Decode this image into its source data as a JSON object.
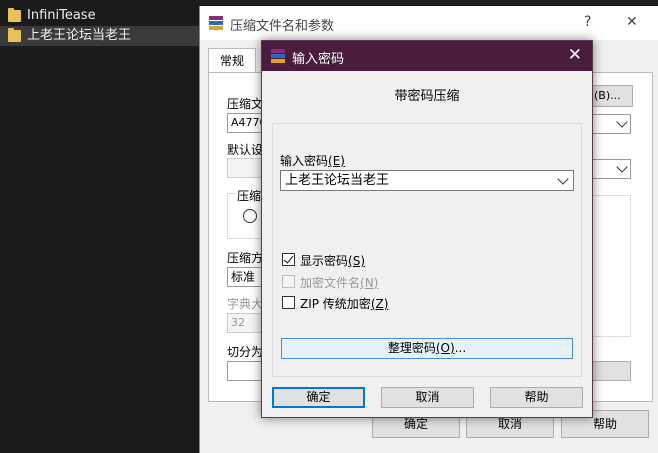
{
  "explorer": {
    "items": [
      {
        "name": "InfiniTease"
      },
      {
        "name": "上老王论坛当老王"
      }
    ]
  },
  "main_dialog": {
    "title": "压缩文件名和参数",
    "help_symbol": "?",
    "close_symbol": "✕",
    "tab_general": "常规",
    "label_archive_name": "压缩文",
    "archive_name_value": "A4770",
    "browse_label": "(B)...",
    "label_default_profile": "默认设",
    "label_update_mode": "压缩",
    "label_method": "压缩方",
    "method_value": "标准",
    "label_dictionary": "字典大",
    "dictionary_value": "32",
    "label_split": "切分为",
    "ok_label": "确定",
    "cancel_label": "取消",
    "help_label": "帮助"
  },
  "password_dialog": {
    "title": "输入密码",
    "heading": "带密码压缩",
    "password_label_text": "输入密码",
    "password_label_key": "(E)",
    "password_value": "上老王论坛当老王",
    "show_password_text": "显示密码",
    "show_password_key": "(S)",
    "show_password_checked": true,
    "encrypt_names_text": "加密文件名",
    "encrypt_names_key": "(N)",
    "encrypt_names_checked": false,
    "zip_legacy_text": "ZIP 传统加密",
    "zip_legacy_key": "(Z)",
    "zip_legacy_checked": false,
    "organize_text": "整理密码",
    "organize_key": "(O)",
    "organize_suffix": "...",
    "ok_label": "确定",
    "cancel_label": "取消",
    "help_label": "帮助"
  }
}
